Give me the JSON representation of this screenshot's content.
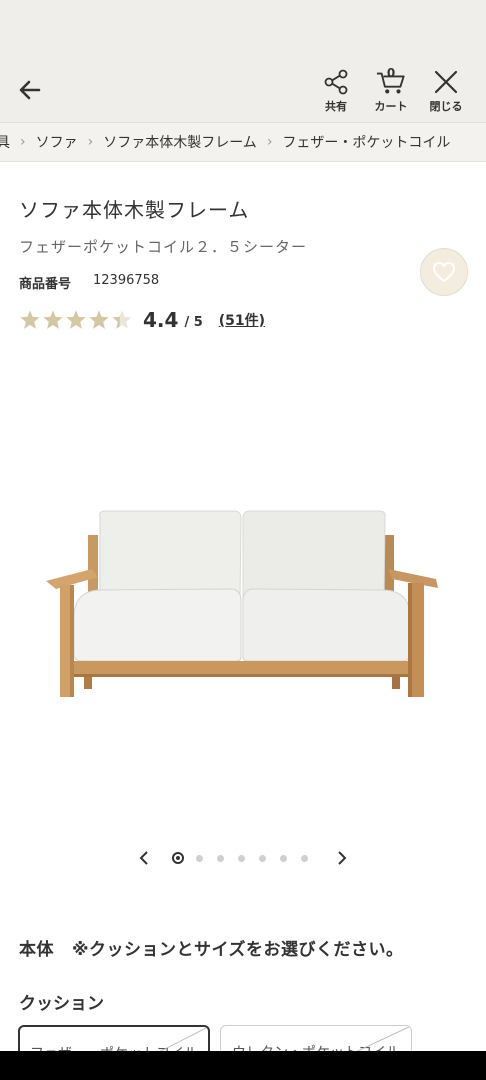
{
  "header": {
    "share_label": "共有",
    "cart_label": "カート",
    "cart_count": "0",
    "close_label": "閉じる"
  },
  "breadcrumb": [
    "具",
    "ソファ",
    "ソファ本体木製フレーム",
    "フェザー・ポケットコイル"
  ],
  "product": {
    "title": "ソファ本体木製フレーム",
    "subtitle": "フェザーポケットコイル２．５シーター",
    "sku_label": "商品番号",
    "sku": "12396758",
    "rating": "4.4",
    "rating_max": "/ 5",
    "rating_value": 4.4,
    "review_link": "(51件)"
  },
  "carousel": {
    "total": 7,
    "current": 1
  },
  "options": {
    "body_label": "本体",
    "body_note": "※クッションとサイズをお選びください。",
    "cushion_label": "クッション",
    "cushion_choices": [
      "フェザー・ポケットコイル",
      "ウレタン・ポケットコイル"
    ]
  },
  "colors": {
    "header_bg": "#efeeea",
    "star_fill": "#d6c7a4",
    "favorite_bg": "#f3ecdf"
  },
  "icons": [
    "back-arrow-icon",
    "share-icon",
    "cart-icon",
    "close-icon",
    "heart-icon",
    "star-icon",
    "chevron-left-icon",
    "chevron-right-icon"
  ]
}
